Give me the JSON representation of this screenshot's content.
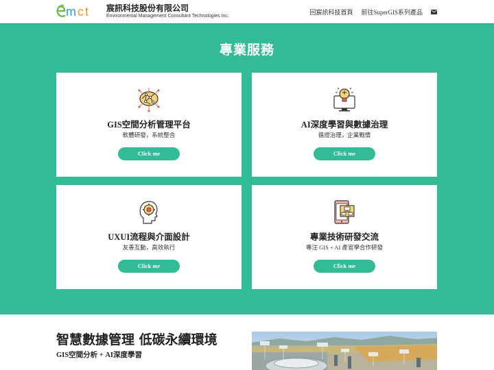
{
  "header": {
    "company_name": "宸訊科技股份有限公司",
    "company_name_en": "Environmental Management Consultant Technologies Inc.",
    "nav": [
      {
        "label": "回宸訊科技首頁"
      },
      {
        "label": "前往SuperGIS系列產品"
      }
    ],
    "mail_icon": "envelope-icon",
    "logo_text": "emct"
  },
  "services": {
    "title": "專業服務",
    "background": "#31bc96",
    "cards": [
      {
        "title": "GIS空間分析管理平台",
        "subtitle": "軟體研發，系統整合",
        "button": "Click me",
        "icon": "brain-network-icon"
      },
      {
        "title": "AI深度學習與數據治理",
        "subtitle": "循證治理，企業戰情",
        "button": "Click me",
        "icon": "lightbulb-monitor-icon"
      },
      {
        "title": "UXUI流程與介面設計",
        "subtitle": "友善互動，高效執行",
        "button": "Click me",
        "icon": "head-gear-icon"
      },
      {
        "title": "專業技術研發交流",
        "subtitle": "專注 GIS + AI 產官學合作研發",
        "button": "Click me",
        "icon": "phone-network-icon"
      }
    ]
  },
  "bottom": {
    "title": "智慧數據管理 低碳永續環境",
    "subtitle": "GIS空間分析 + AI深度學習"
  }
}
